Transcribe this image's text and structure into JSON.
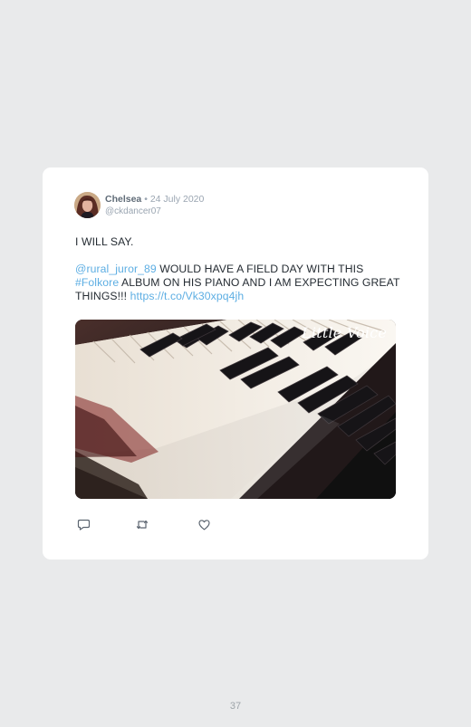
{
  "tweet": {
    "author": {
      "name": "Chelsea",
      "separator": "•",
      "date": "24 July 2020",
      "handle": "@ckdancer07"
    },
    "text": {
      "line1": "I WILL SAY.",
      "mention": "@rural_juror_89",
      "part_after_mention": " WOULD HAVE A FIELD DAY WITH THIS ",
      "hashtag": "#Folkore",
      "part_after_hashtag": " ALBUM ON HIS PIANO AND I AM EXPECTING GREAT THINGS!!! ",
      "url": "https://t.co/Vk30xpq4jh"
    },
    "image": {
      "watermark": "Little Voice"
    },
    "actions": {
      "reply_icon": "comment-icon",
      "retweet_icon": "retweet-icon",
      "like_icon": "heart-icon"
    }
  },
  "page": {
    "number": "37"
  },
  "colors": {
    "background": "#e9eaeb",
    "card": "#ffffff",
    "link": "#5daee3",
    "text": "#252c33",
    "muted": "#9aa5b1"
  }
}
